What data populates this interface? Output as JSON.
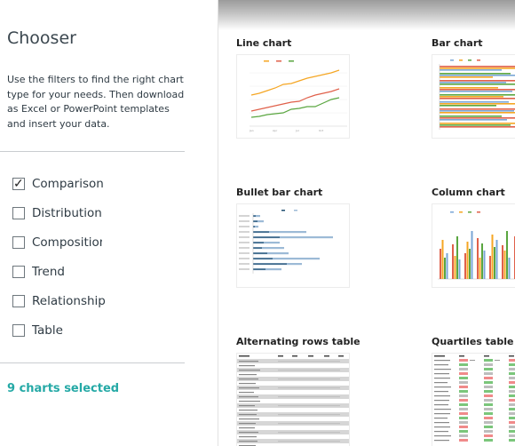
{
  "sidebar": {
    "title": "Chooser",
    "description": "Use the filters to find the right chart type for your needs. Then download as Excel or PowerPoint templates and insert your data.",
    "filters": [
      {
        "label": "Comparison",
        "checked": true
      },
      {
        "label": "Distribution",
        "checked": false
      },
      {
        "label": "Composition",
        "checked": false
      },
      {
        "label": "Trend",
        "checked": false
      },
      {
        "label": "Relationship",
        "checked": false
      },
      {
        "label": "Table",
        "checked": false
      }
    ],
    "selected_count": "9 charts selected"
  },
  "gallery": {
    "cards": [
      {
        "title": "Line chart",
        "thumb_icon": "line-chart-thumbnail"
      },
      {
        "title": "Bar chart",
        "thumb_icon": "bar-chart-thumbnail"
      },
      {
        "title": "Bullet bar chart",
        "thumb_icon": "bullet-bar-chart-thumbnail"
      },
      {
        "title": "Column chart",
        "thumb_icon": "column-chart-thumbnail"
      },
      {
        "title": "Alternating rows table",
        "thumb_icon": "alternating-rows-table-thumbnail"
      },
      {
        "title": "Quartiles table",
        "thumb_icon": "quartiles-table-thumbnail"
      }
    ]
  },
  "colors": {
    "accent": "#25a9a6",
    "text": "#2f3b44",
    "divider": "#c9cdd0",
    "series_orange": "#f5a623",
    "series_red": "#e0604a",
    "series_green": "#5aa640",
    "series_blue": "#7aa6d6",
    "bullet_dark": "#1f4e70"
  }
}
